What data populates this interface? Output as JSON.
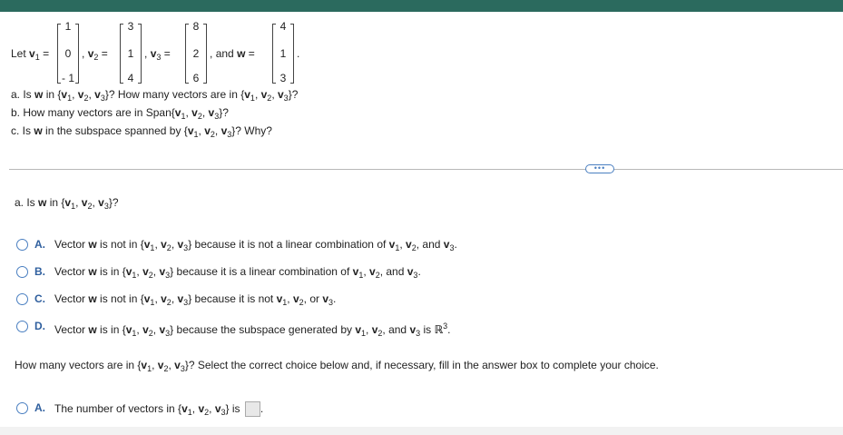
{
  "problem": {
    "let_label": "Let",
    "v1_label": "v",
    "v1_sub": "1",
    "v2_label": "v",
    "v2_sub": "2",
    "v3_label": "v",
    "v3_sub": "3",
    "w_label": "w",
    "and_text": "and",
    "eq": "=",
    "comma": ",",
    "period": ".",
    "v1": [
      "1",
      "0",
      "- 1"
    ],
    "v2": [
      "3",
      "1",
      "4"
    ],
    "v3": [
      "8",
      "2",
      "6"
    ],
    "w": [
      "4",
      "1",
      "3"
    ],
    "q_a_1": "a. Is ",
    "q_a_2": " in {",
    "q_a_3": "}? How many vectors are in {",
    "q_a_4": "}?",
    "q_b_1": "b. How many vectors are in Span{",
    "q_b_2": "}?",
    "q_c_1": "c. Is ",
    "q_c_2": " in the subspace spanned by {",
    "q_c_3": "}? Why?"
  },
  "more_button": "•••",
  "part_a": {
    "q1": "a. Is ",
    "q2": " in {",
    "q3": "}?",
    "choices": [
      {
        "letter": "A.",
        "t1": "Vector ",
        "t2": " is not in {",
        "t3": "} because it is not a linear combination of ",
        "t4": ", and "
      },
      {
        "letter": "B.",
        "t1": "Vector ",
        "t2": " is in {",
        "t3": "} because it is a linear combination of ",
        "t4": ", and "
      },
      {
        "letter": "C.",
        "t1": "Vector ",
        "t2": " is not in {",
        "t3": "} because it is not ",
        "t4": ", or "
      },
      {
        "letter": "D.",
        "t1": "Vector ",
        "t2": " is in {",
        "t3": "} because the subspace generated by ",
        "t4": ", and ",
        "t5": " is ",
        "R": "ℝ",
        "R_sup": "3"
      }
    ]
  },
  "part_a2": {
    "question": "How many vectors are in {",
    "question_end": "}? Select the correct choice below and, if necessary, fill in the answer box to complete your choice.",
    "choice_letter": "A.",
    "choice_t1": "The number of vectors in {",
    "choice_t2": "} is"
  }
}
